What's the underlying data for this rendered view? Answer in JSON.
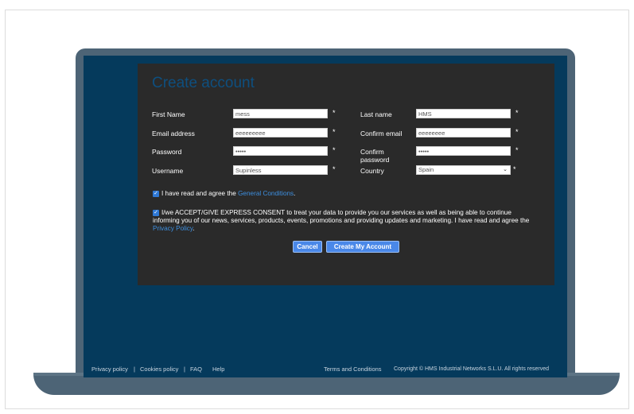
{
  "form": {
    "title": "Create account",
    "fields": {
      "first_name": {
        "label": "First Name",
        "value": "mess"
      },
      "last_name": {
        "label": "Last name",
        "value": "HMS"
      },
      "email": {
        "label": "Email address",
        "value": "eeeeeeeee"
      },
      "confirm_email": {
        "label": "Confirm email",
        "value": "eeeeeeee"
      },
      "password": {
        "label": "Password",
        "value": "•••••"
      },
      "confirm_password": {
        "label": "Confirm password",
        "value": "•••••"
      },
      "username": {
        "label": "Username",
        "value": "Supinless"
      },
      "country": {
        "label": "Country",
        "value": "Spain"
      }
    },
    "required_marker": "*",
    "terms": {
      "prefix": "I have read and agree the",
      "link": "General Conditions",
      "suffix": "."
    },
    "consent": {
      "text": "I/we ACCEPT/GIVE EXPRESS CONSENT to treat your data to provide you our services as well as being able to continue informing you of our news, services, products, events, promotions and providing updates and marketing. I have read and agree the",
      "link": "Privacy Policy",
      "suffix": "."
    },
    "buttons": {
      "cancel": "Cancel",
      "create": "Create My Account"
    }
  },
  "footer": {
    "privacy": "Privacy policy",
    "sep1": "|",
    "cookies": "Cookies policy",
    "sep2": "|",
    "faq": "FAQ",
    "help": "Help",
    "terms": "Terms and Conditions",
    "copyright": "Copyright © HMS Industrial Networks S.L.U. All rights reserved"
  },
  "colors": {
    "screen_bg": "#053a5c",
    "panel_bg": "#2a2a2a",
    "button_bg": "#4a88e8",
    "link": "#3d8fe0",
    "laptop": "#4d6476"
  }
}
